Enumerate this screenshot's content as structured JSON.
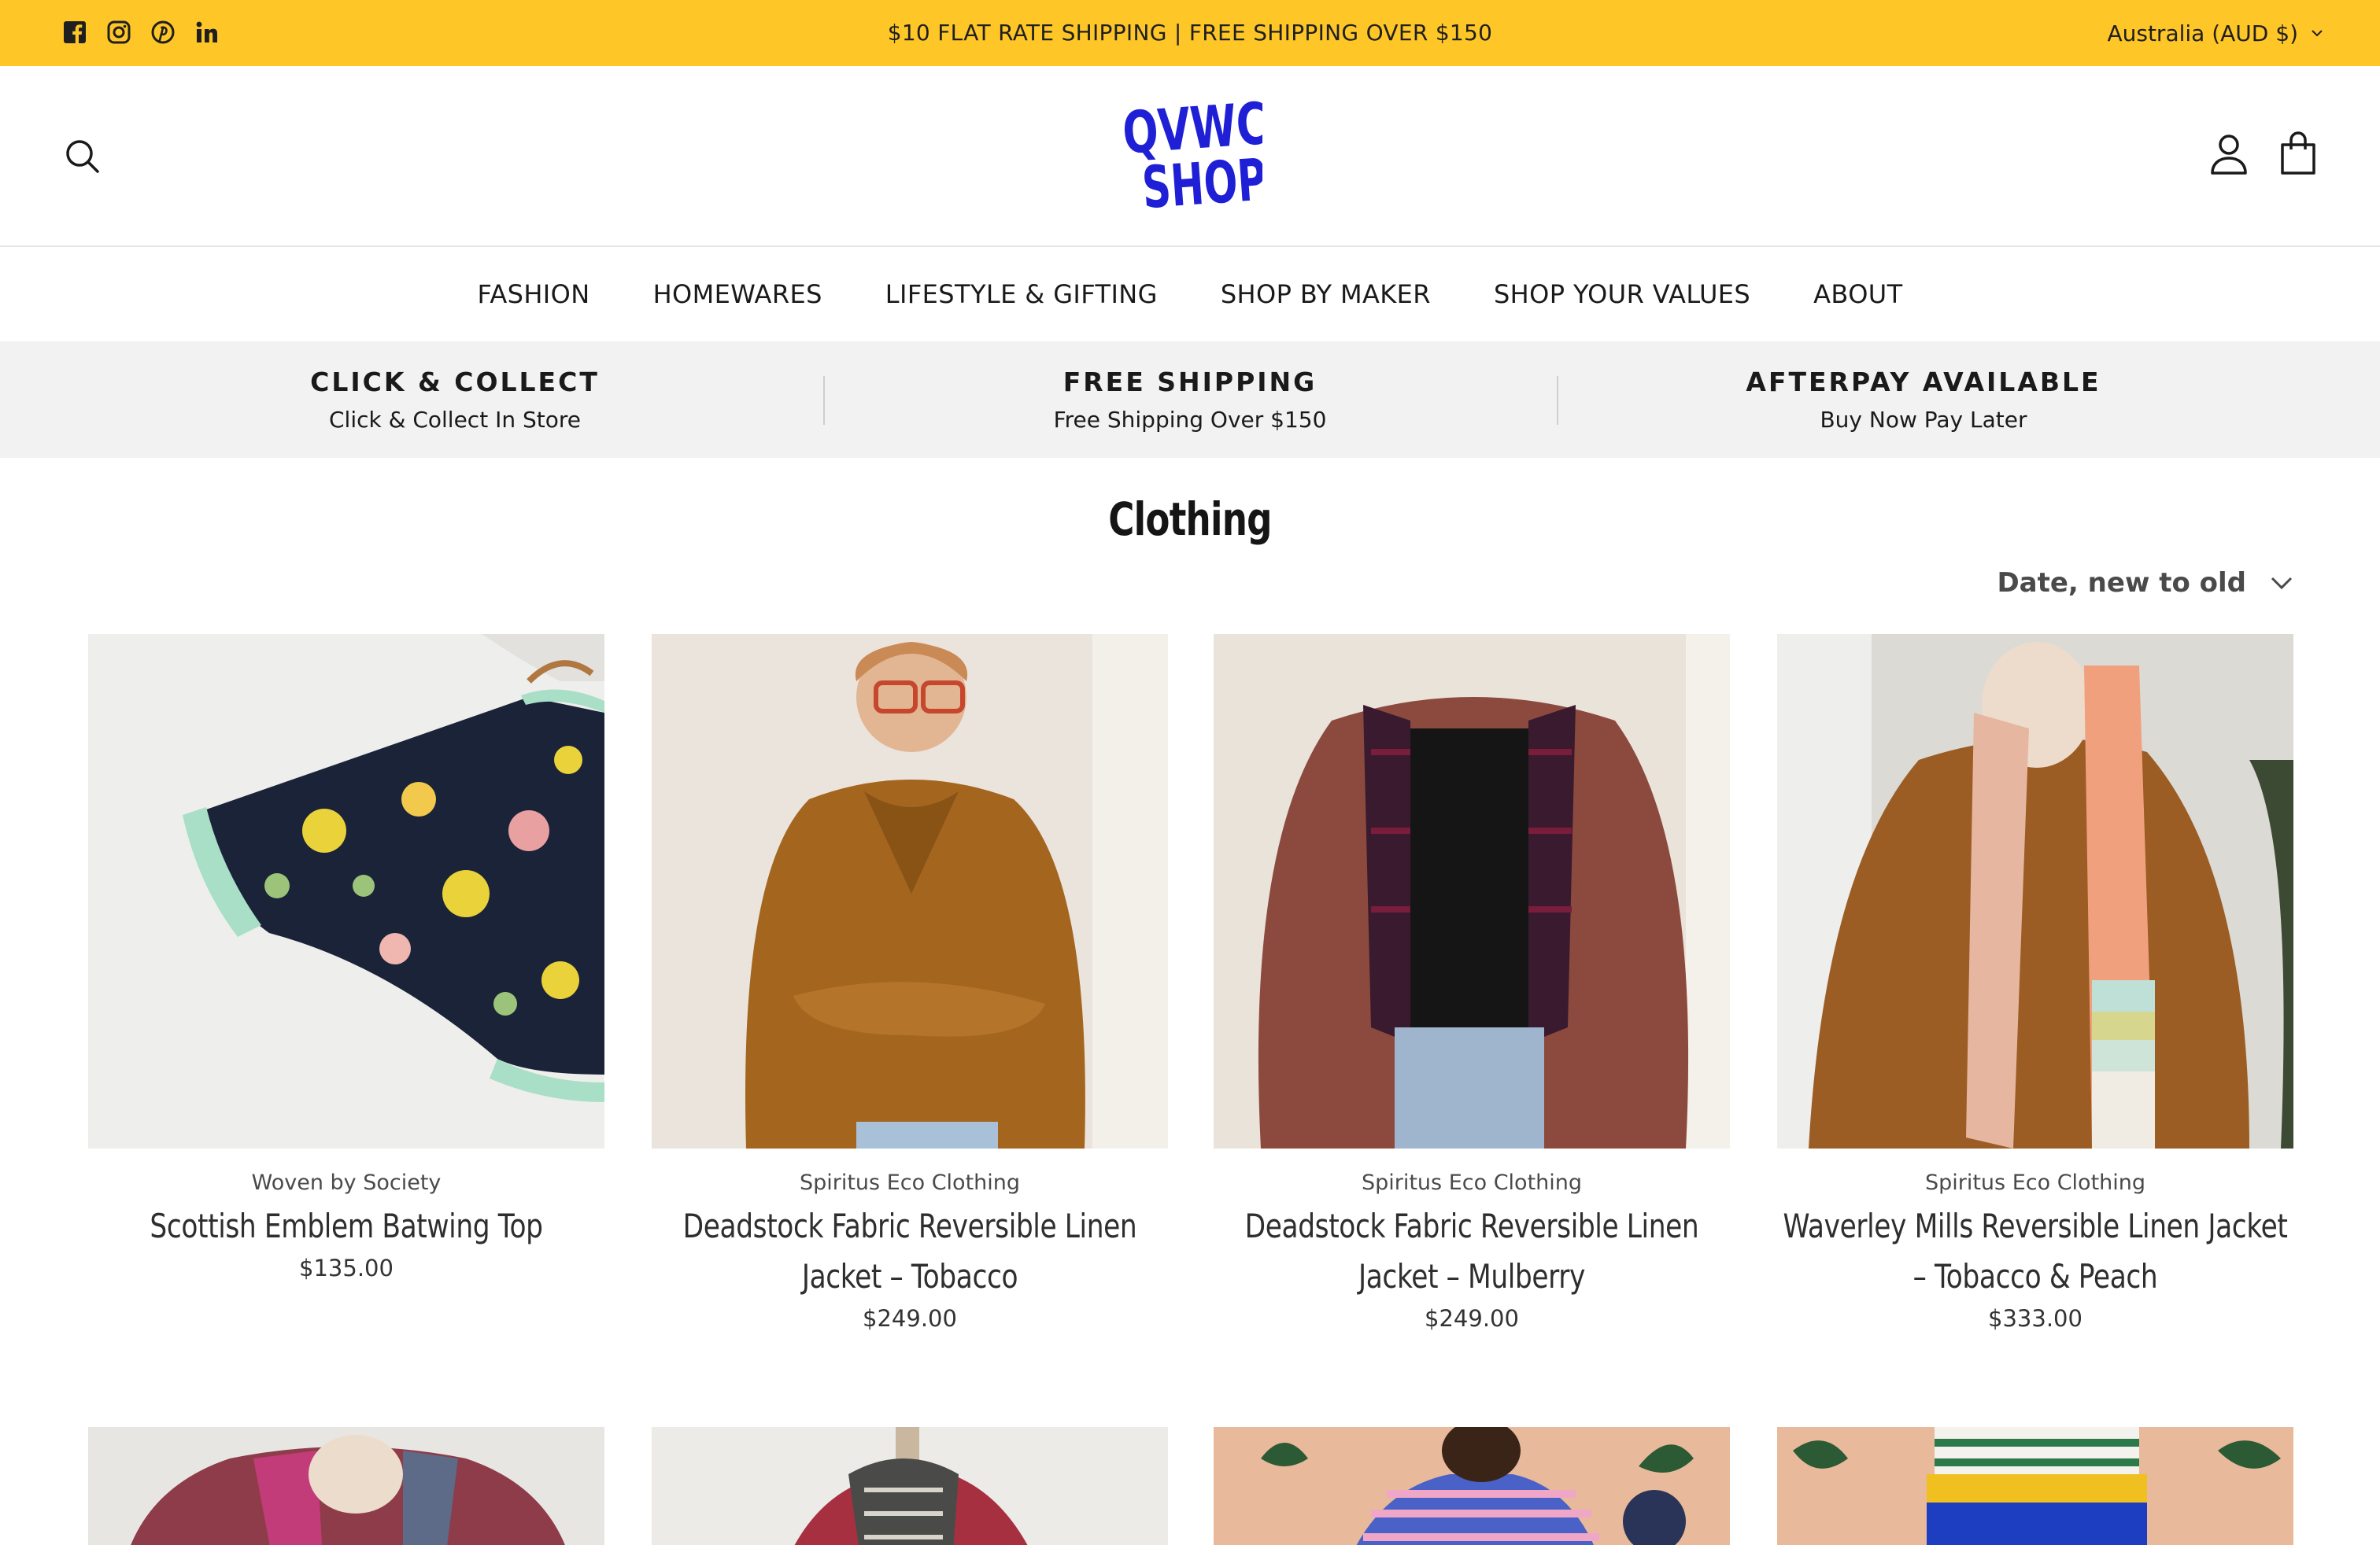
{
  "announcement": {
    "text": "$10 FLAT RATE SHIPPING | FREE SHIPPING OVER $150",
    "currency": "Australia (AUD $)",
    "social": [
      "facebook-icon",
      "instagram-icon",
      "pinterest-icon",
      "linkedin-icon"
    ]
  },
  "header": {
    "logo_line1": "QVWC",
    "logo_line2": "SHOP!"
  },
  "nav": {
    "items": [
      "FASHION",
      "HOMEWARES",
      "LIFESTYLE & GIFTING",
      "SHOP BY MAKER",
      "SHOP YOUR VALUES",
      "ABOUT"
    ]
  },
  "strip": [
    {
      "title": "CLICK & COLLECT",
      "sub": "Click & Collect In Store"
    },
    {
      "title": "FREE SHIPPING",
      "sub": "Free Shipping Over $150"
    },
    {
      "title": "AFTERPAY AVAILABLE",
      "sub": "Buy Now Pay Later"
    }
  ],
  "collection": {
    "title": "Clothing",
    "sort": "Date, new to old"
  },
  "products": [
    {
      "vendor": "Woven by Society",
      "title": "Scottish Emblem Batwing Top",
      "price": "$135.00"
    },
    {
      "vendor": "Spiritus Eco Clothing",
      "title": "Deadstock Fabric Reversible Linen Jacket – Tobacco",
      "price": "$249.00"
    },
    {
      "vendor": "Spiritus Eco Clothing",
      "title": "Deadstock Fabric Reversible Linen Jacket – Mulberry",
      "price": "$249.00"
    },
    {
      "vendor": "Spiritus Eco Clothing",
      "title": "Waverley Mills Reversible Linen Jacket – Tobacco & Peach",
      "price": "$333.00"
    }
  ],
  "colors": {
    "announcement_bg": "#ffc627",
    "logo_blue": "#1f1fd6",
    "strip_bg": "#f2f2f2"
  }
}
